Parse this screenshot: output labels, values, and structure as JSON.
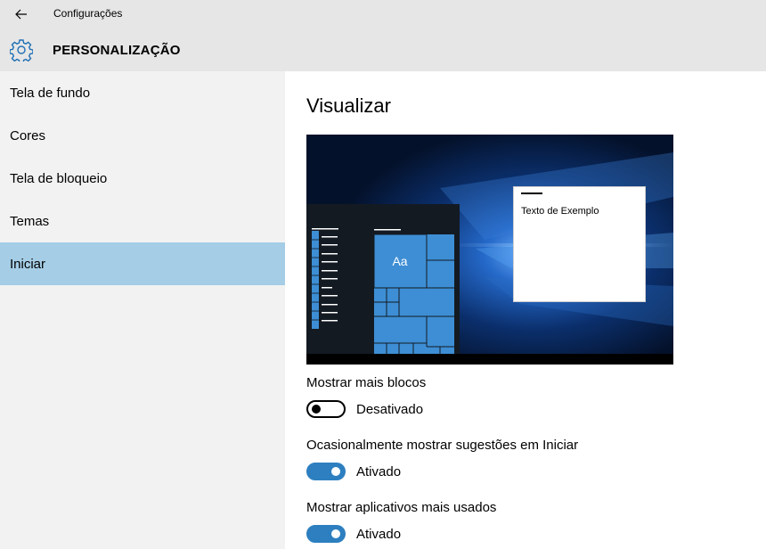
{
  "window": {
    "title": "Configurações",
    "back_icon": "back-arrow-icon"
  },
  "header": {
    "icon": "gear-icon",
    "title": "PERSONALIZAÇÃO"
  },
  "sidebar": {
    "items": [
      {
        "label": "Tela de fundo",
        "active": false
      },
      {
        "label": "Cores",
        "active": false
      },
      {
        "label": "Tela de bloqueio",
        "active": false
      },
      {
        "label": "Temas",
        "active": false
      },
      {
        "label": "Iniciar",
        "active": true
      }
    ]
  },
  "main": {
    "title": "Visualizar",
    "preview": {
      "sample_text": "Texto de Exemplo",
      "tile_label": "Aa",
      "accent_color": "#3d8ed4"
    },
    "settings": [
      {
        "label": "Mostrar mais blocos",
        "state": false,
        "status": "Desativado"
      },
      {
        "label": "Ocasionalmente mostrar sugestões em Iniciar",
        "state": true,
        "status": "Ativado"
      },
      {
        "label": "Mostrar aplicativos mais usados",
        "state": true,
        "status": "Ativado"
      }
    ]
  },
  "colors": {
    "titlebar": "#e6e6e6",
    "sidebar": "#f2f2f2",
    "active_item": "#a5cde6",
    "toggle_on": "#2d7fc0"
  }
}
